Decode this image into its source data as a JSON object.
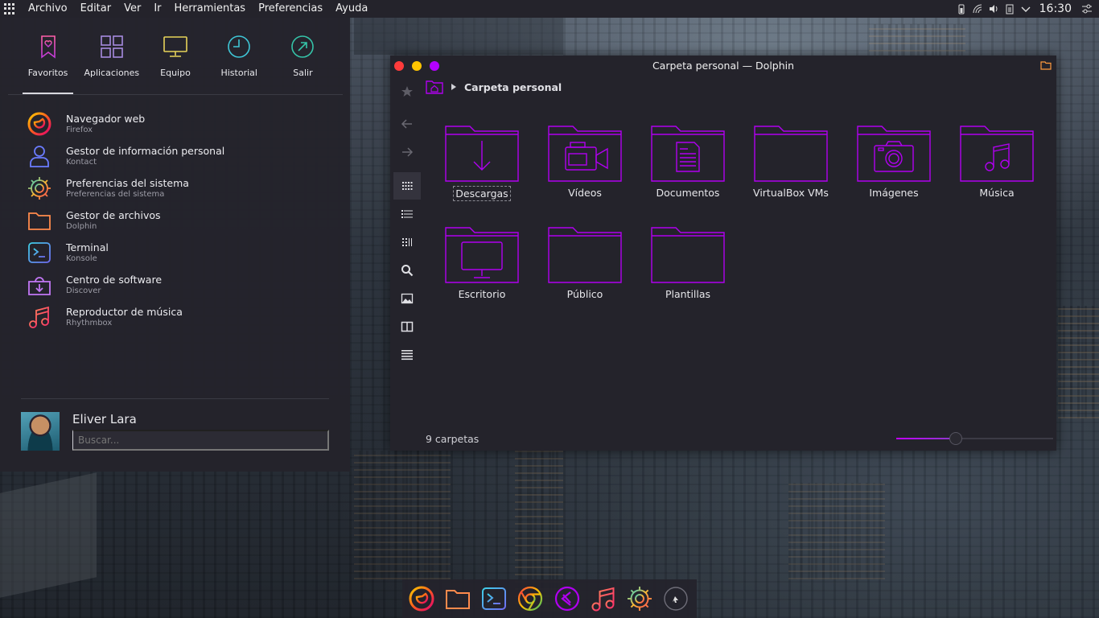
{
  "top_panel": {
    "menu": [
      "Archivo",
      "Editar",
      "Ver",
      "Ir",
      "Herramientas",
      "Preferencias",
      "Ayuda"
    ],
    "clock": "16:30"
  },
  "launcher": {
    "tabs": [
      {
        "label": "Favoritos",
        "icon": "bookmark-heart-icon",
        "active": true
      },
      {
        "label": "Aplicaciones",
        "icon": "apps-grid-icon"
      },
      {
        "label": "Equipo",
        "icon": "monitor-icon"
      },
      {
        "label": "Historial",
        "icon": "clock-icon"
      },
      {
        "label": "Salir",
        "icon": "exit-icon"
      }
    ],
    "favorites": [
      {
        "name": "Navegador web",
        "sub": "Firefox",
        "icon": "firefox-icon"
      },
      {
        "name": "Gestor de información personal",
        "sub": "Kontact",
        "icon": "contact-icon"
      },
      {
        "name": "Preferencias del sistema",
        "sub": "Preferencias del sistema",
        "icon": "settings-gear-icon"
      },
      {
        "name": "Gestor de archivos",
        "sub": "Dolphin",
        "icon": "folder-icon"
      },
      {
        "name": "Terminal",
        "sub": "Konsole",
        "icon": "terminal-icon"
      },
      {
        "name": "Centro de software",
        "sub": "Discover",
        "icon": "software-center-icon"
      },
      {
        "name": "Reproductor de música",
        "sub": "Rhythmbox",
        "icon": "music-note-icon"
      }
    ],
    "user_name": "Eliver Lara",
    "search_placeholder": "Buscar..."
  },
  "dolphin": {
    "title": "Carpeta personal — Dolphin",
    "breadcrumb": "Carpeta personal",
    "folders": [
      {
        "label": "Descargas",
        "icon": "download-arrow-icon",
        "selected": true
      },
      {
        "label": "Vídeos",
        "icon": "video-camera-icon"
      },
      {
        "label": "Documentos",
        "icon": "document-icon"
      },
      {
        "label": "VirtualBox VMs",
        "icon": "folder-icon"
      },
      {
        "label": "Imágenes",
        "icon": "photo-camera-icon"
      },
      {
        "label": "Música",
        "icon": "music-note-icon"
      },
      {
        "label": "Escritorio",
        "icon": "desktop-monitor-icon"
      },
      {
        "label": "Público",
        "icon": "folder-icon"
      },
      {
        "label": "Plantillas",
        "icon": "folder-icon"
      }
    ],
    "status": "9 carpetas",
    "zoom_fraction": 0.38
  },
  "dock": [
    "firefox-icon",
    "files-icon",
    "terminal-icon",
    "chrome-icon",
    "vscode-icon",
    "music-icon",
    "settings-icon",
    "clock-icon"
  ],
  "colors": {
    "accent": "#b000f0",
    "panel": "#24232b"
  }
}
